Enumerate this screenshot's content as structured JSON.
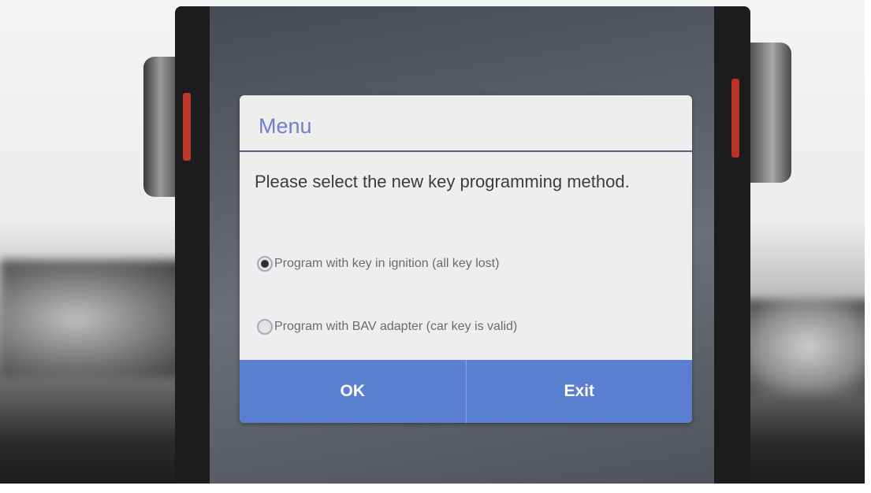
{
  "dialog": {
    "title": "Menu",
    "message": "Please select the new key programming method.",
    "options": [
      {
        "label": "Program with key in ignition (all key lost)",
        "selected": true
      },
      {
        "label": "Program with BAV adapter (car key is valid)",
        "selected": false
      }
    ],
    "ok_label": "OK",
    "exit_label": "Exit"
  },
  "colors": {
    "accent": "#5b7fd0",
    "title": "#6f7fc9",
    "dialog_background": "#eeeeee"
  },
  "icons": {
    "selected_radio": "radio-selected-icon",
    "unselected_radio": "radio-unselected-icon"
  }
}
